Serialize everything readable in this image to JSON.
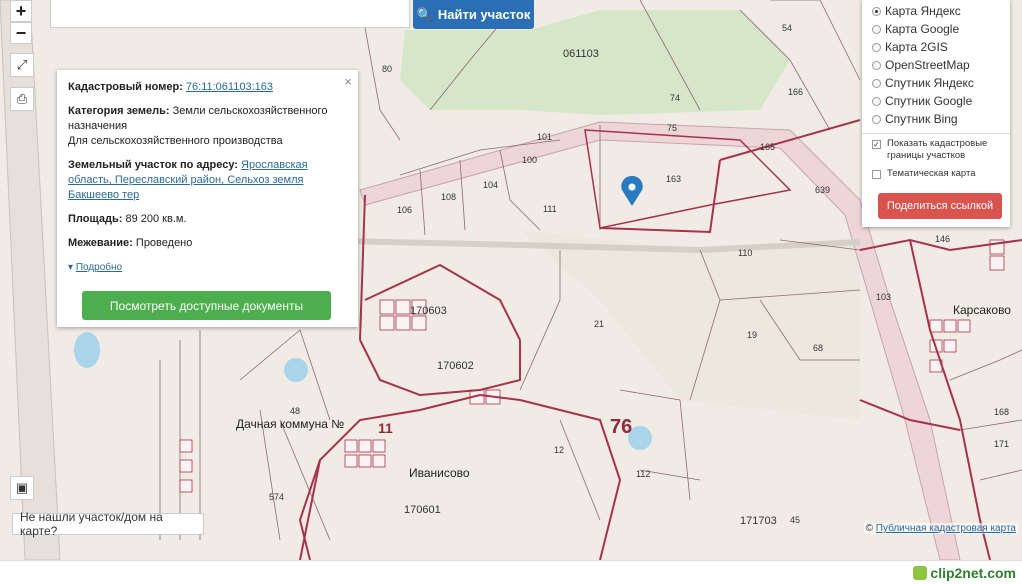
{
  "search": {
    "button_label": "Найти участок"
  },
  "controls": {
    "zoom_in": "+",
    "zoom_out": "−"
  },
  "info_card": {
    "cadastral_label": "Кадастровый номер:",
    "cadastral_value": "76:11:061103:163",
    "category_label": "Категория земель:",
    "category_value_line1": "Земли сельскохозяйственного",
    "category_value_line2": "назначения",
    "usage": "Для сельскохозяйственного производства",
    "address_label": "Земельный участок по адресу:",
    "address_line1": "Ярославская",
    "address_line2": "область, Переславский район, Сельхоз земля",
    "address_line3": "Бакшеево тер",
    "area_label": "Площадь:",
    "area_value": "89 200 кв.м.",
    "survey_label": "Межевание:",
    "survey_value": "Проведено",
    "more_link": "Подробно",
    "docs_button": "Посмотреть доступные документы",
    "close": "×"
  },
  "layers": {
    "options": [
      "Карта Яндекс",
      "Карта Google",
      "Карта 2GIS",
      "OpenStreetMap",
      "Спутник Яндекс",
      "Спутник Google",
      "Спутник Bing"
    ],
    "selected": "Карта Яндекс",
    "show_borders_line1": "Показать кадастровые",
    "show_borders_line2": "границы участков",
    "thematic": "Тематическая карта",
    "share_button": "Поделиться ссылкой"
  },
  "map_labels": {
    "l061103": "061103",
    "l80": "80",
    "l54": "54",
    "l74": "74",
    "l166": "166",
    "l163": "163",
    "l101": "101",
    "l75": "75",
    "l165": "165",
    "l639": "639",
    "l100": "100",
    "l104": "104",
    "l108": "108",
    "l106": "106",
    "l111": "111",
    "l110": "110",
    "l21": "21",
    "l19": "19",
    "l68": "68",
    "l103": "103",
    "l170603": "170603",
    "l170602": "170602",
    "l76": "76",
    "l11": "11",
    "l12": "12",
    "l112": "112",
    "l574": "574",
    "l170601": "170601",
    "l171703": "171703",
    "l48": "48",
    "l45": "45",
    "l146": "146",
    "l168": "168",
    "l171": "171",
    "dacha": "Дачная коммуна №",
    "ivanisovo": "Иванисово",
    "karsakovo": "Карсаково"
  },
  "not_found": "Не нашли участок/дом на карте?",
  "attribution": {
    "prefix": "©",
    "link": "Публичная кадастровая карта"
  },
  "watermark": "clip2net.com",
  "colors": {
    "parcel_border": "#a8324a",
    "forest": "#d6e6c8",
    "search_button": "#2a6fb5",
    "docs_button": "#4cae4c",
    "share_button": "#d9534f",
    "marker": "#2a7ac0"
  }
}
